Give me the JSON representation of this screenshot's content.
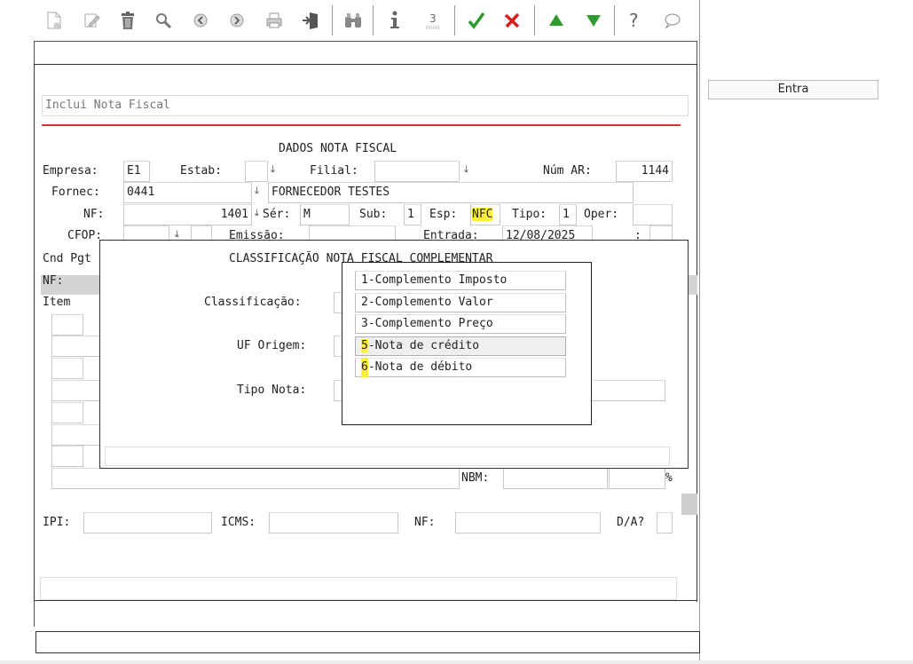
{
  "toolbar": {
    "items": [
      "new-doc",
      "edit",
      "delete",
      "search",
      "previous",
      "next",
      "print",
      "exit",
      "binoculars",
      "info",
      "list",
      "confirm",
      "cancel",
      "up",
      "down",
      "help",
      "comment"
    ]
  },
  "entra_button": "Entra",
  "form": {
    "title_placeholder": "Inclui Nota Fiscal",
    "section_title": "DADOS NOTA FISCAL",
    "empresa_label": "Empresa:",
    "empresa_value": "E1",
    "estab_label": "Estab:",
    "filial_label": "Filial:",
    "num_ar_label": "Núm AR:",
    "num_ar_value": "1144",
    "fornec_label": "Fornec:",
    "fornec_value": "0441",
    "fornec_name": "FORNECEDOR TESTES",
    "nf_label": "NF:",
    "nf_value": "1401",
    "ser_label": "Sér:",
    "ser_value": "M",
    "sub_label": "Sub:",
    "sub_value": "1",
    "esp_label": "Esp:",
    "esp_value": "NFC",
    "tipo_label": "Tipo:",
    "tipo_value": "1",
    "oper_label": "Oper:",
    "cfop_label": "CFOP:",
    "emissao_label": "Emissão:",
    "entrada_label": "Entrada:",
    "entrada_value": "12/08/2025",
    "cnd_pgt_label": "Cnd Pgt",
    "nf_row_label": "NF:",
    "item_label": "Item",
    "nbm_label": "NBM:",
    "percent": "%",
    "ipi_label": "IPI:",
    "icms_label": "ICMS:",
    "nf2_label": "NF:",
    "da_label": "D/A?"
  },
  "dialog": {
    "title": "CLASSIFICAÇÃO NOTA FISCAL COMPLEMENTAR",
    "classificacao_label": "Classificação:",
    "uf_origem_label": "UF Origem:",
    "tipo_nota_label": "Tipo Nota:"
  },
  "menu": {
    "items": [
      {
        "num": "1",
        "text": "-Complemento Imposto"
      },
      {
        "num": "2",
        "text": "-Complemento Valor"
      },
      {
        "num": "3",
        "text": "-Complemento Preço"
      },
      {
        "num": "5",
        "text": "-Nota de crédito"
      },
      {
        "num": "6",
        "text": "-Nota de débito"
      }
    ]
  },
  "colors": {
    "red_line": "#e03030",
    "highlight": "#ffef3a",
    "confirm_green": "#2e9b2e",
    "cancel_red": "#d42020"
  }
}
